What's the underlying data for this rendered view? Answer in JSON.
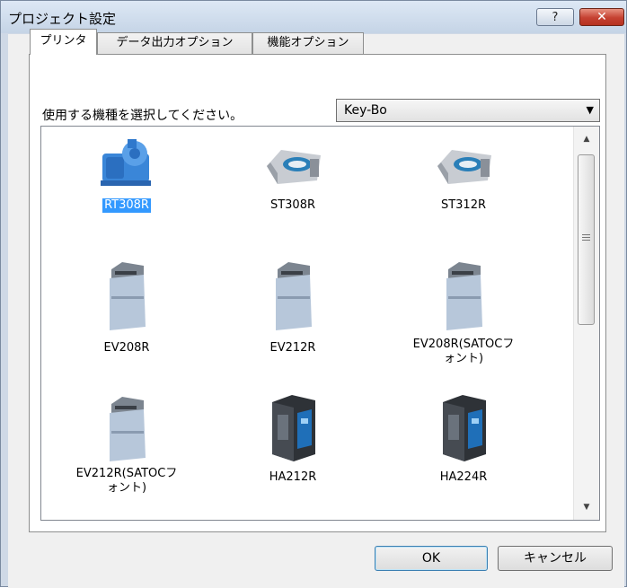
{
  "window": {
    "title": "プロジェクト設定",
    "help_label": "?",
    "close_label": "✕"
  },
  "tabs": [
    {
      "label": "プリンタ",
      "active": true
    },
    {
      "label": "データ出力オプション",
      "active": false
    },
    {
      "label": "機能オプション",
      "active": false
    }
  ],
  "prompt": "使用する機種を選択してください。",
  "model_select": {
    "value": "Key-Bo"
  },
  "printers": [
    {
      "name": "RT308R",
      "icon": "rt-printer-icon",
      "selected": true
    },
    {
      "name": "ST308R",
      "icon": "st-printer-icon",
      "selected": false
    },
    {
      "name": "ST312R",
      "icon": "st-printer-icon",
      "selected": false
    },
    {
      "name": "EV208R",
      "icon": "ev-printer-icon",
      "selected": false
    },
    {
      "name": "EV212R",
      "icon": "ev-printer-icon",
      "selected": false
    },
    {
      "name": "EV208R(SATOCフォント)",
      "icon": "ev-printer-icon",
      "selected": false
    },
    {
      "name": "EV212R(SATOCフォント)",
      "icon": "ev-printer-icon",
      "selected": false
    },
    {
      "name": "HA212R",
      "icon": "ha-printer-icon",
      "selected": false
    },
    {
      "name": "HA224R",
      "icon": "ha-printer-icon",
      "selected": false
    }
  ],
  "buttons": {
    "ok": "OK",
    "cancel": "キャンセル"
  }
}
